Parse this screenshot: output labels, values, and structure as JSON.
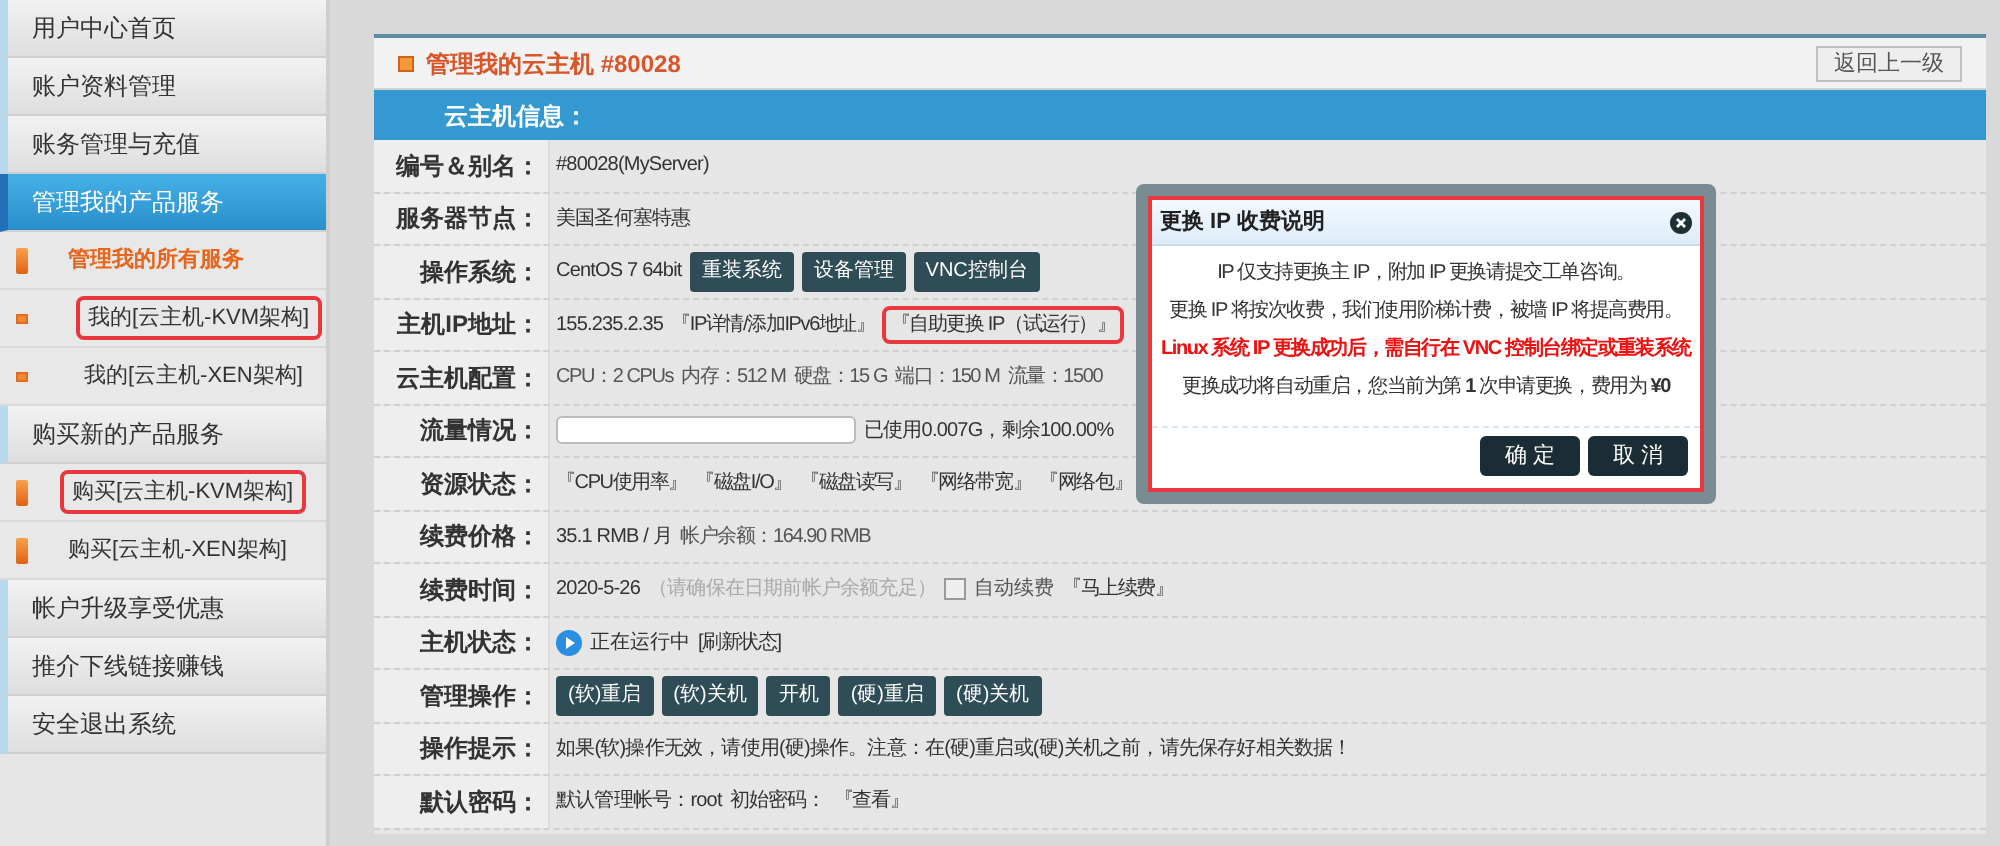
{
  "sidebar": {
    "items": [
      {
        "label": "用户中心首页",
        "kind": "menu",
        "selected": false,
        "annotated": false
      },
      {
        "label": "账户资料管理",
        "kind": "menu",
        "selected": false,
        "annotated": false
      },
      {
        "label": "账务管理与充值",
        "kind": "menu",
        "selected": false,
        "annotated": false
      },
      {
        "label": "管理我的产品服务",
        "kind": "menu",
        "selected": true,
        "annotated": false
      },
      {
        "label": "管理我的所有服务",
        "kind": "bar",
        "selected": true,
        "annotated": false
      },
      {
        "label": "我的[云主机-KVM架构]",
        "kind": "dot",
        "selected": false,
        "annotated": true
      },
      {
        "label": "我的[云主机-XEN架构]",
        "kind": "dot",
        "selected": false,
        "annotated": false
      },
      {
        "label": "购买新的产品服务",
        "kind": "menu",
        "selected": false,
        "annotated": false
      },
      {
        "label": "购买[云主机-KVM架构]",
        "kind": "bar",
        "selected": false,
        "annotated": true
      },
      {
        "label": "购买[云主机-XEN架构]",
        "kind": "bar",
        "selected": false,
        "annotated": false
      },
      {
        "label": "帐户升级享受优惠",
        "kind": "menu",
        "selected": false,
        "annotated": false
      },
      {
        "label": "推介下线链接赚钱",
        "kind": "menu",
        "selected": false,
        "annotated": false
      },
      {
        "label": "安全退出系统",
        "kind": "menu",
        "selected": false,
        "annotated": false
      }
    ]
  },
  "panel": {
    "title": "管理我的云主机 #80028",
    "back_button": "返回上一级",
    "section": "云主机信息：",
    "rows": [
      {
        "label": "编号＆别名：",
        "items": [
          {
            "kind": "text",
            "text": "#80028(MyServer)"
          }
        ]
      },
      {
        "label": "服务器节点：",
        "items": [
          {
            "kind": "text",
            "text": "美国圣何塞特惠"
          }
        ]
      },
      {
        "label": "操作系统：",
        "items": [
          {
            "kind": "text",
            "text": "CentOS 7 64bit"
          },
          {
            "kind": "button",
            "text": "重装系统"
          },
          {
            "kind": "button",
            "text": "设备管理"
          },
          {
            "kind": "button",
            "text": "VNC控制台"
          }
        ]
      },
      {
        "label": "主机IP地址：",
        "items": [
          {
            "kind": "text",
            "text": "155.235.2.35"
          },
          {
            "kind": "link",
            "text": "『IP详情/添加IPv6地址』",
            "annotated": false
          },
          {
            "kind": "link",
            "text": "『自助更换 IP（试运行）』",
            "annotated": true
          }
        ]
      },
      {
        "label": "云主机配置：",
        "items": [
          {
            "kind": "spec",
            "text": "CPU：2 CPUs"
          },
          {
            "kind": "spec",
            "text": "内存：512 M"
          },
          {
            "kind": "spec",
            "text": "硬盘：15 G"
          },
          {
            "kind": "spec",
            "text": "端口：150 M"
          },
          {
            "kind": "spec",
            "text": "流量：1500"
          }
        ]
      },
      {
        "label": "流量情况：",
        "items": [
          {
            "kind": "meter",
            "level": 0
          },
          {
            "kind": "text",
            "text": "已使用0.007G，剩余100.00%"
          }
        ]
      },
      {
        "label": "资源状态：",
        "items": [
          {
            "kind": "link",
            "text": "『CPU使用率』",
            "annotated": false
          },
          {
            "kind": "link",
            "text": "『磁盘I/O』",
            "annotated": false
          },
          {
            "kind": "link",
            "text": "『磁盘读写』",
            "annotated": false
          },
          {
            "kind": "link",
            "text": "『网络带宽』",
            "annotated": false
          },
          {
            "kind": "link",
            "text": "『网络包』",
            "annotated": false
          }
        ]
      },
      {
        "label": "续费价格：",
        "items": [
          {
            "kind": "text",
            "text": "35.1 RMB / 月"
          },
          {
            "kind": "spec",
            "text": "帐户余额：164.90 RMB"
          }
        ]
      },
      {
        "label": "续费时间：",
        "items": [
          {
            "kind": "text",
            "text": "2020-5-26"
          },
          {
            "kind": "note",
            "text": "（请确保在日期前帐户余额充足）"
          },
          {
            "kind": "checkbox",
            "text": "自动续费",
            "checked": false
          },
          {
            "kind": "link",
            "text": "『马上续费』",
            "annotated": false
          }
        ]
      },
      {
        "label": "主机状态：",
        "items": [
          {
            "kind": "status",
            "text": "正在运行中"
          },
          {
            "kind": "link",
            "text": "[刷新状态]",
            "annotated": false
          }
        ]
      },
      {
        "label": "管理操作：",
        "items": [
          {
            "kind": "button",
            "text": "(软)重启"
          },
          {
            "kind": "button",
            "text": "(软)关机"
          },
          {
            "kind": "button",
            "text": "开机"
          },
          {
            "kind": "button",
            "text": "(硬)重启"
          },
          {
            "kind": "button",
            "text": "(硬)关机"
          }
        ]
      },
      {
        "label": "操作提示：",
        "items": [
          {
            "kind": "text",
            "text": "如果(软)操作无效，请使用(硬)操作。注意：在(硬)重启或(硬)关机之前，请先保存好相关数据！"
          }
        ]
      },
      {
        "label": "默认密码：",
        "items": [
          {
            "kind": "text",
            "text": "默认管理帐号：root"
          },
          {
            "kind": "text",
            "text": "初始密码："
          },
          {
            "kind": "link",
            "text": "『查看』",
            "annotated": false
          }
        ]
      }
    ]
  },
  "dialog": {
    "title": "更换 IP 收费说明",
    "annotated": true,
    "lines": [
      {
        "text": "IP 仅支持更换主 IP，附加 IP 更换请提交工单咨询。",
        "warning": false
      },
      {
        "text": "更换 IP 将按次收费，我们使用阶梯计费，被墙 IP 将提高费用。",
        "warning": false
      },
      {
        "text": "Linux 系统 IP 更换成功后，需自行在 VNC 控制台绑定或重装系统",
        "warning": true
      },
      {
        "text": "更换成功将自动重启，您当前为第 **1** 次申请更换，费用为 **¥0**",
        "warning": false
      }
    ],
    "buttons": [
      "确 定",
      "取 消"
    ]
  }
}
